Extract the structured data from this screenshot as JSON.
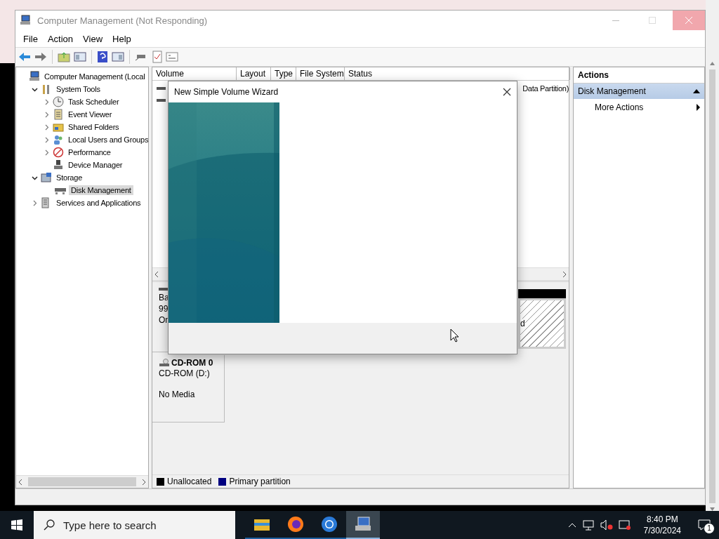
{
  "window": {
    "title": "Computer Management (Not Responding)"
  },
  "menu": [
    "File",
    "Action",
    "View",
    "Help"
  ],
  "tree": {
    "items": [
      {
        "label": "Computer Management (Local",
        "kind": "computer",
        "selected": false,
        "children": [
          {
            "label": "System Tools",
            "kind": "tools",
            "expanded": true,
            "selected": false,
            "children": [
              {
                "label": "Task Scheduler",
                "kind": "clock",
                "expanded": false,
                "selected": false
              },
              {
                "label": "Event Viewer",
                "kind": "log",
                "expanded": false,
                "selected": false
              },
              {
                "label": "Shared Folders",
                "kind": "share",
                "expanded": false,
                "selected": false
              },
              {
                "label": "Local Users and Groups",
                "kind": "users",
                "expanded": false,
                "selected": false
              },
              {
                "label": "Performance",
                "kind": "performance",
                "expanded": false,
                "selected": false
              },
              {
                "label": "Device Manager",
                "kind": "device",
                "selected": false
              }
            ]
          },
          {
            "label": "Storage",
            "kind": "storage",
            "expanded": true,
            "selected": false,
            "children": [
              {
                "label": "Disk Management",
                "kind": "disk",
                "selected": true
              }
            ]
          },
          {
            "label": "Services and Applications",
            "kind": "services",
            "expanded": false,
            "selected": false
          }
        ]
      }
    ]
  },
  "volume_list": {
    "columns": [
      "Volume",
      "Layout",
      "Type",
      "File System",
      "Status"
    ],
    "rows": [
      {
        "status_tail": "Data Partition)"
      },
      {}
    ]
  },
  "disks": [
    {
      "kind": "basic",
      "lines": [
        "Ba",
        "99",
        "On"
      ],
      "partition_tail": "d"
    },
    {
      "kind": "cdrom",
      "title": "CD-ROM 0",
      "lines": [
        "CD-ROM (D:)",
        "No Media"
      ]
    }
  ],
  "legend": [
    {
      "label": "Unallocated",
      "color": "#000000"
    },
    {
      "label": "Primary partition",
      "color": "#000080"
    }
  ],
  "actions": {
    "title": "Actions",
    "sections": [
      {
        "label": "Disk Management",
        "expanded": true,
        "items": [
          "More Actions"
        ]
      }
    ]
  },
  "dialog": {
    "title": "New Simple Volume Wizard"
  },
  "taskbar": {
    "search_placeholder": "Type here to search",
    "apps": [
      {
        "kind": "explorer",
        "selected": false
      },
      {
        "kind": "firefox",
        "selected": false
      },
      {
        "kind": "chrome",
        "selected": false
      },
      {
        "kind": "management",
        "selected": true
      }
    ],
    "time": "8:40 PM",
    "date": "7/30/2024",
    "notifications": "1"
  }
}
